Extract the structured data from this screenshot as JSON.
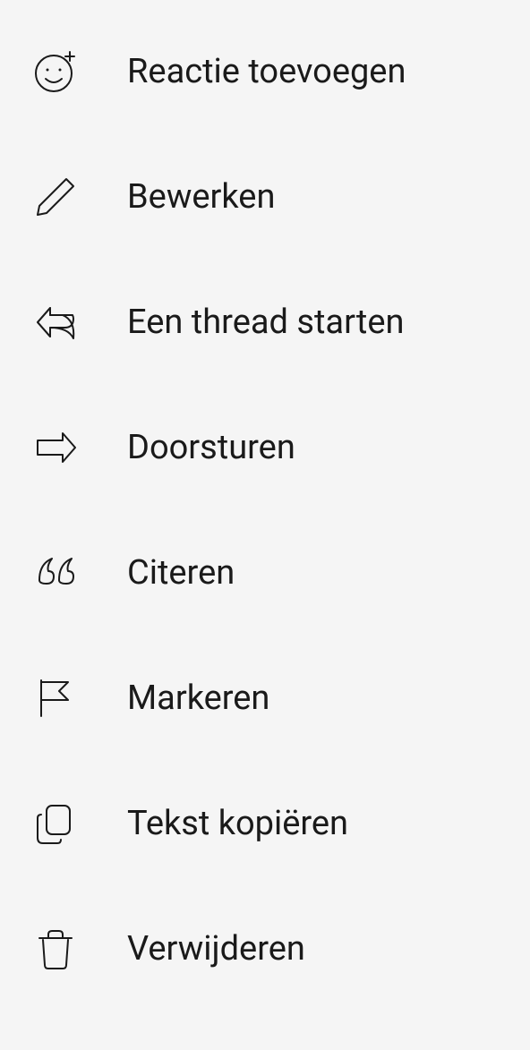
{
  "menu": {
    "items": [
      {
        "label": "Reactie toevoegen",
        "icon": "smile-plus-icon",
        "action": "add-reaction"
      },
      {
        "label": "Bewerken",
        "icon": "pencil-icon",
        "action": "edit"
      },
      {
        "label": "Een thread starten",
        "icon": "reply-arrow-icon",
        "action": "start-thread"
      },
      {
        "label": "Doorsturen",
        "icon": "forward-arrow-icon",
        "action": "forward"
      },
      {
        "label": "Citeren",
        "icon": "quote-icon",
        "action": "quote"
      },
      {
        "label": "Markeren",
        "icon": "flag-icon",
        "action": "mark"
      },
      {
        "label": "Tekst kopiëren",
        "icon": "copy-icon",
        "action": "copy-text"
      },
      {
        "label": "Verwijderen",
        "icon": "trash-icon",
        "action": "delete"
      }
    ]
  }
}
